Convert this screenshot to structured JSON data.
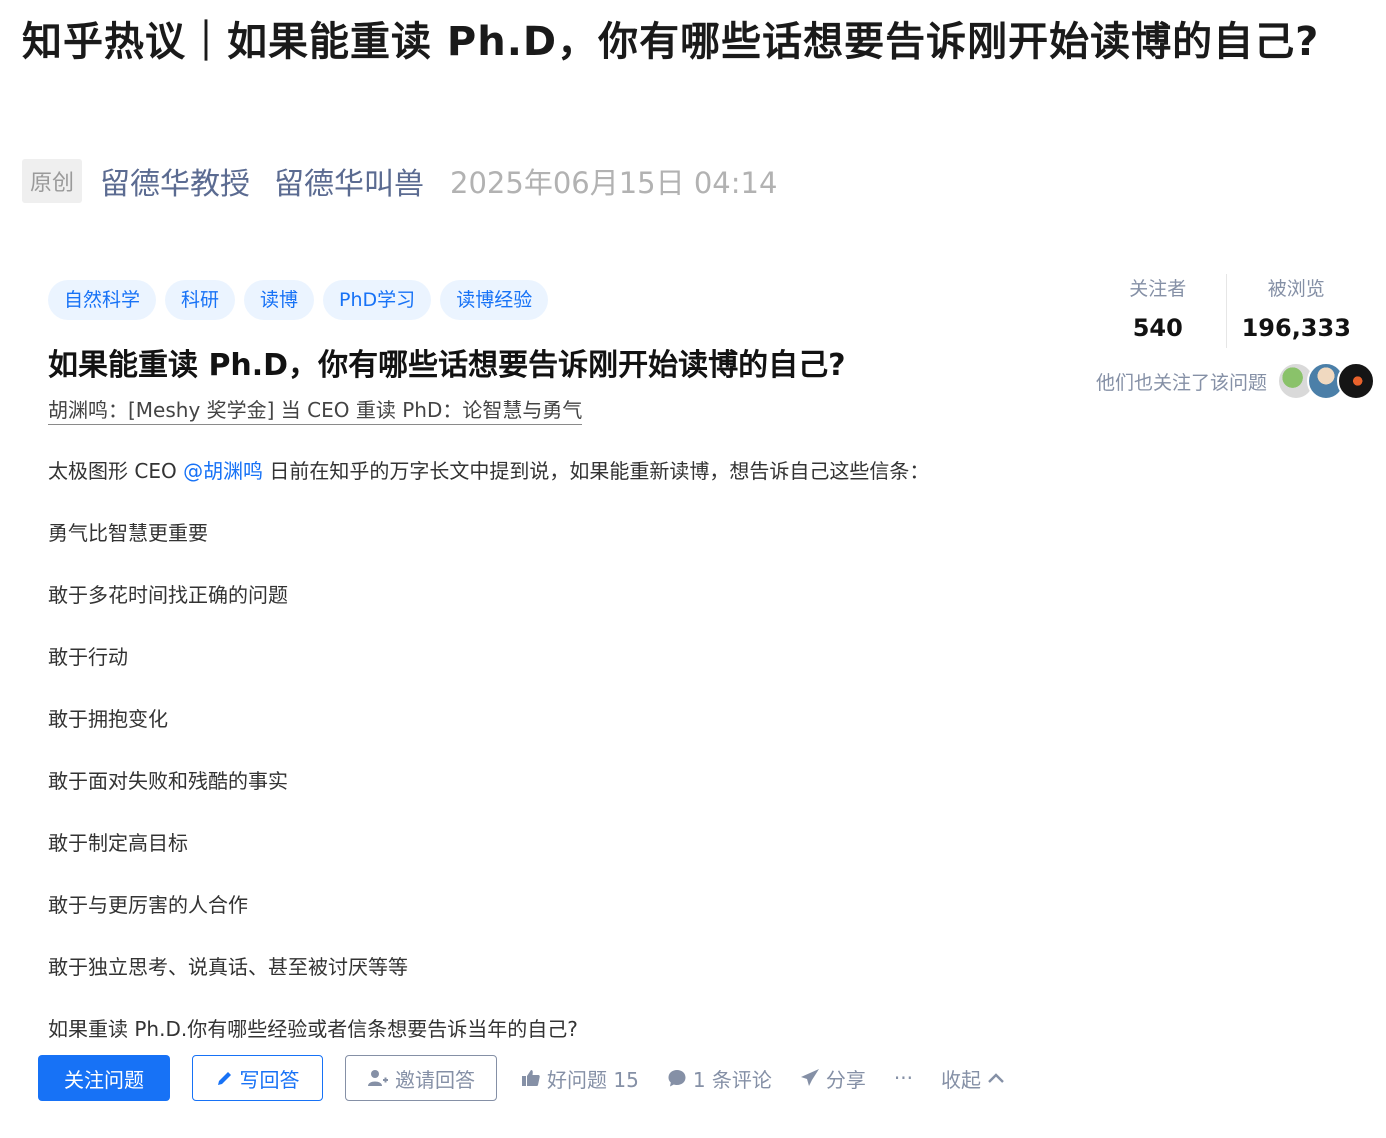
{
  "article": {
    "title": "知乎热议｜如果能重读 Ph.D，你有哪些话想要告诉刚开始读博的自己?",
    "badge": "原创",
    "authors": [
      "留德华教授",
      "留德华叫兽"
    ],
    "publish_time": "2025年06月15日 04:14"
  },
  "question": {
    "tags": [
      "自然科学",
      "科研",
      "读博",
      "PhD学习",
      "读博经验"
    ],
    "title": "如果能重读 Ph.D，你有哪些话想要告诉刚开始读博的自己?",
    "linked_answer": "胡渊鸣：[Meshy 奖学金] 当 CEO 重读 PhD：论智慧与勇气",
    "intro": {
      "before": "太极图形 CEO ",
      "mention": "@胡渊鸣",
      "after": " 日前在知乎的万字长文中提到说，如果能重新读博，想告诉自己这些信条："
    },
    "beliefs": [
      "勇气比智慧更重要",
      "敢于多花时间找正确的问题",
      "敢于行动",
      "敢于拥抱变化",
      "敢于面对失败和残酷的事实",
      "敢于制定高目标",
      "敢于与更厉害的人合作",
      "敢于独立思考、说真话、甚至被讨厌等等"
    ],
    "closing": "如果重读 Ph.D.你有哪些经验或者信条想要告诉当年的自己?"
  },
  "stats": {
    "followers_label": "关注者",
    "followers_value": "540",
    "views_label": "被浏览",
    "views_value": "196,333",
    "also_follow_text": "他们也关注了该问题"
  },
  "actions": {
    "follow": "关注问题",
    "write_answer": "写回答",
    "invite": "邀请回答",
    "good_question": "好问题 15",
    "comments": "1 条评论",
    "share": "分享",
    "more": "···",
    "collapse": "收起"
  },
  "colors": {
    "zhihu_blue": "#1772f6",
    "tag_bg": "#ebf4ff",
    "meta_gray": "#8590a6",
    "author_blue": "#5b6b91"
  },
  "icons": {
    "write": "pencil-icon",
    "invite": "add-user-icon",
    "good_question": "thumbs-up-icon",
    "comments": "comment-bubble-icon",
    "share": "paper-plane-icon",
    "collapse": "chevron-up-icon"
  }
}
